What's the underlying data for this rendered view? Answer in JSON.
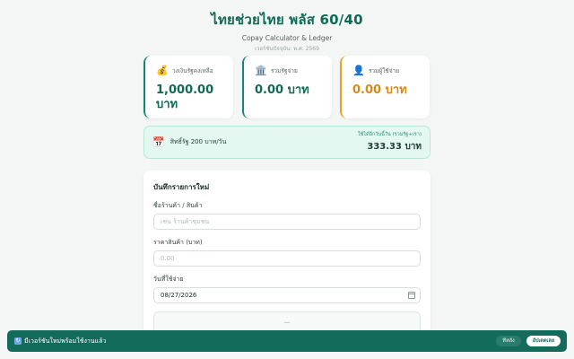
{
  "header": {
    "title": "ไทยช่วยไทย พลัส 60/40",
    "subtitle": "Copay Calculator & Ledger",
    "version": "เวอร์ชันปัจจุบัน: พ.ศ. 2569"
  },
  "cards": [
    {
      "icon": "money-bag-icon",
      "glyph": "💰",
      "label": "วงเงินรัฐคงเหลือ",
      "value": "1,000.00 บาท"
    },
    {
      "icon": "bank-icon",
      "glyph": "🏛️",
      "label": "รวมรัฐจ่าย",
      "value": "0.00 บาท"
    },
    {
      "icon": "user-icon",
      "glyph": "👤",
      "label": "รวมผู้ใช้จ่าย",
      "value": "0.00 บาท"
    }
  ],
  "budget": {
    "icon": "calendar-icon",
    "glyph": "📅",
    "label": "สิทธิ์รัฐ 200 บาท/วัน",
    "right_label": "ใช้ได้อีกวันนี้วัน (รวมรัฐ+เรา)",
    "right_value": "333.33 บาท"
  },
  "form": {
    "title": "บันทึกรายการใหม่",
    "shop_label": "ชื่อร้านค้า / สินค้า",
    "shop_placeholder": "เช่น ร้านค้าชุมชน",
    "price_label": "ราคาสินค้า (บาท)",
    "price_placeholder": "0.00",
    "date_label": "วันที่ใช้จ่าย",
    "date_value": "08/27/2026",
    "submit_label": "—"
  },
  "update_bar": {
    "icon": "refresh-icon",
    "glyph": "↻",
    "message": "มีเวอร์ชันใหม่พร้อมใช้งานแล้ว",
    "later_label": "ทีหลัง",
    "update_label": "อัปเดตเลย"
  },
  "colors": {
    "accent": "#0f6b56",
    "user_accent": "#d98a10",
    "update_bar": "#136b5c"
  }
}
